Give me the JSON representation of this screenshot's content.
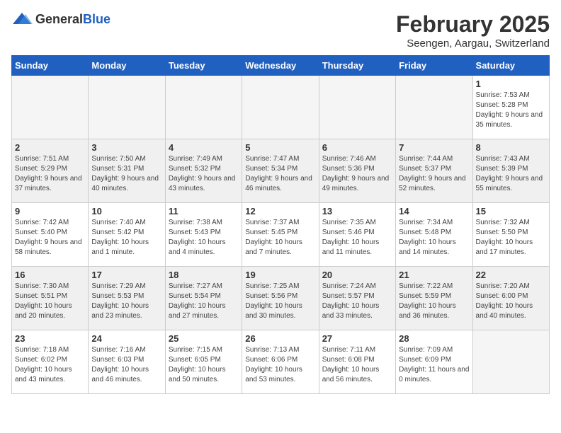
{
  "header": {
    "logo_general": "General",
    "logo_blue": "Blue",
    "title": "February 2025",
    "subtitle": "Seengen, Aargau, Switzerland"
  },
  "days_of_week": [
    "Sunday",
    "Monday",
    "Tuesday",
    "Wednesday",
    "Thursday",
    "Friday",
    "Saturday"
  ],
  "weeks": [
    {
      "alt": false,
      "days": [
        {
          "num": "",
          "info": "",
          "empty": true
        },
        {
          "num": "",
          "info": "",
          "empty": true
        },
        {
          "num": "",
          "info": "",
          "empty": true
        },
        {
          "num": "",
          "info": "",
          "empty": true
        },
        {
          "num": "",
          "info": "",
          "empty": true
        },
        {
          "num": "",
          "info": "",
          "empty": true
        },
        {
          "num": "1",
          "info": "Sunrise: 7:53 AM\nSunset: 5:28 PM\nDaylight: 9 hours and 35 minutes.",
          "empty": false
        }
      ]
    },
    {
      "alt": true,
      "days": [
        {
          "num": "2",
          "info": "Sunrise: 7:51 AM\nSunset: 5:29 PM\nDaylight: 9 hours and 37 minutes.",
          "empty": false
        },
        {
          "num": "3",
          "info": "Sunrise: 7:50 AM\nSunset: 5:31 PM\nDaylight: 9 hours and 40 minutes.",
          "empty": false
        },
        {
          "num": "4",
          "info": "Sunrise: 7:49 AM\nSunset: 5:32 PM\nDaylight: 9 hours and 43 minutes.",
          "empty": false
        },
        {
          "num": "5",
          "info": "Sunrise: 7:47 AM\nSunset: 5:34 PM\nDaylight: 9 hours and 46 minutes.",
          "empty": false
        },
        {
          "num": "6",
          "info": "Sunrise: 7:46 AM\nSunset: 5:36 PM\nDaylight: 9 hours and 49 minutes.",
          "empty": false
        },
        {
          "num": "7",
          "info": "Sunrise: 7:44 AM\nSunset: 5:37 PM\nDaylight: 9 hours and 52 minutes.",
          "empty": false
        },
        {
          "num": "8",
          "info": "Sunrise: 7:43 AM\nSunset: 5:39 PM\nDaylight: 9 hours and 55 minutes.",
          "empty": false
        }
      ]
    },
    {
      "alt": false,
      "days": [
        {
          "num": "9",
          "info": "Sunrise: 7:42 AM\nSunset: 5:40 PM\nDaylight: 9 hours and 58 minutes.",
          "empty": false
        },
        {
          "num": "10",
          "info": "Sunrise: 7:40 AM\nSunset: 5:42 PM\nDaylight: 10 hours and 1 minute.",
          "empty": false
        },
        {
          "num": "11",
          "info": "Sunrise: 7:38 AM\nSunset: 5:43 PM\nDaylight: 10 hours and 4 minutes.",
          "empty": false
        },
        {
          "num": "12",
          "info": "Sunrise: 7:37 AM\nSunset: 5:45 PM\nDaylight: 10 hours and 7 minutes.",
          "empty": false
        },
        {
          "num": "13",
          "info": "Sunrise: 7:35 AM\nSunset: 5:46 PM\nDaylight: 10 hours and 11 minutes.",
          "empty": false
        },
        {
          "num": "14",
          "info": "Sunrise: 7:34 AM\nSunset: 5:48 PM\nDaylight: 10 hours and 14 minutes.",
          "empty": false
        },
        {
          "num": "15",
          "info": "Sunrise: 7:32 AM\nSunset: 5:50 PM\nDaylight: 10 hours and 17 minutes.",
          "empty": false
        }
      ]
    },
    {
      "alt": true,
      "days": [
        {
          "num": "16",
          "info": "Sunrise: 7:30 AM\nSunset: 5:51 PM\nDaylight: 10 hours and 20 minutes.",
          "empty": false
        },
        {
          "num": "17",
          "info": "Sunrise: 7:29 AM\nSunset: 5:53 PM\nDaylight: 10 hours and 23 minutes.",
          "empty": false
        },
        {
          "num": "18",
          "info": "Sunrise: 7:27 AM\nSunset: 5:54 PM\nDaylight: 10 hours and 27 minutes.",
          "empty": false
        },
        {
          "num": "19",
          "info": "Sunrise: 7:25 AM\nSunset: 5:56 PM\nDaylight: 10 hours and 30 minutes.",
          "empty": false
        },
        {
          "num": "20",
          "info": "Sunrise: 7:24 AM\nSunset: 5:57 PM\nDaylight: 10 hours and 33 minutes.",
          "empty": false
        },
        {
          "num": "21",
          "info": "Sunrise: 7:22 AM\nSunset: 5:59 PM\nDaylight: 10 hours and 36 minutes.",
          "empty": false
        },
        {
          "num": "22",
          "info": "Sunrise: 7:20 AM\nSunset: 6:00 PM\nDaylight: 10 hours and 40 minutes.",
          "empty": false
        }
      ]
    },
    {
      "alt": false,
      "days": [
        {
          "num": "23",
          "info": "Sunrise: 7:18 AM\nSunset: 6:02 PM\nDaylight: 10 hours and 43 minutes.",
          "empty": false
        },
        {
          "num": "24",
          "info": "Sunrise: 7:16 AM\nSunset: 6:03 PM\nDaylight: 10 hours and 46 minutes.",
          "empty": false
        },
        {
          "num": "25",
          "info": "Sunrise: 7:15 AM\nSunset: 6:05 PM\nDaylight: 10 hours and 50 minutes.",
          "empty": false
        },
        {
          "num": "26",
          "info": "Sunrise: 7:13 AM\nSunset: 6:06 PM\nDaylight: 10 hours and 53 minutes.",
          "empty": false
        },
        {
          "num": "27",
          "info": "Sunrise: 7:11 AM\nSunset: 6:08 PM\nDaylight: 10 hours and 56 minutes.",
          "empty": false
        },
        {
          "num": "28",
          "info": "Sunrise: 7:09 AM\nSunset: 6:09 PM\nDaylight: 11 hours and 0 minutes.",
          "empty": false
        },
        {
          "num": "",
          "info": "",
          "empty": true
        }
      ]
    }
  ]
}
